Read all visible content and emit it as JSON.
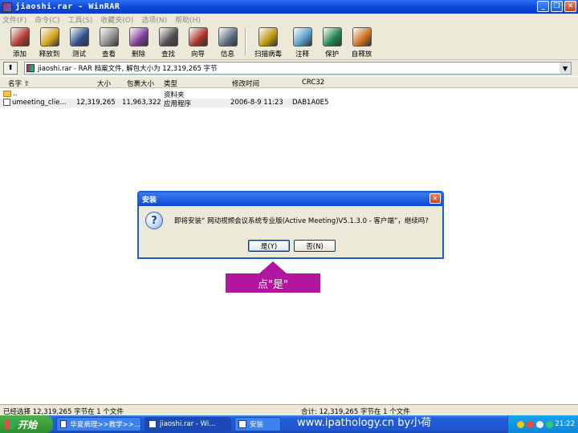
{
  "window": {
    "title": "jiaoshi.rar - WinRAR"
  },
  "menu": [
    "文件(F)",
    "命令(C)",
    "工具(S)",
    "收藏夹(O)",
    "选项(N)",
    "帮助(H)"
  ],
  "toolbar": [
    {
      "label": "添加",
      "icon": "add-icon",
      "color": "#b03a2e"
    },
    {
      "label": "释放到",
      "icon": "extract-to-icon",
      "color": "#d4a017"
    },
    {
      "label": "测试",
      "icon": "test-icon",
      "color": "#2e4d8f"
    },
    {
      "label": "查看",
      "icon": "view-icon",
      "color": "#8a8a8a"
    },
    {
      "label": "删除",
      "icon": "delete-icon",
      "color": "#7d3c98"
    },
    {
      "label": "查找",
      "icon": "find-icon",
      "color": "#4d4d4d"
    },
    {
      "label": "向导",
      "icon": "wizard-icon",
      "color": "#a93226"
    },
    {
      "label": "信息",
      "icon": "info-icon",
      "color": "#5d6d7e"
    },
    {
      "label": "扫描病毒",
      "icon": "virus-scan-icon",
      "color": "#b7950b"
    },
    {
      "label": "注释",
      "icon": "comment-icon",
      "color": "#5499c7"
    },
    {
      "label": "保护",
      "icon": "protect-icon",
      "color": "#1e8449"
    },
    {
      "label": "自释放",
      "icon": "sfx-icon",
      "color": "#ca6f1e"
    }
  ],
  "address": {
    "text": "jiaoshi.rar - RAR 档案文件, 解包大小为 12,319,265 字节"
  },
  "columns": {
    "name": "名字",
    "size": "大小",
    "packed": "包裹大小",
    "type": "类型",
    "modified": "修改时间",
    "crc": "CRC32"
  },
  "files": [
    {
      "name": "..",
      "size": "",
      "packed": "",
      "type": "资料夹",
      "modified": "",
      "crc": ""
    },
    {
      "name": "umeeting_clie...",
      "size": "12,319,265",
      "packed": "11,963,322",
      "type": "应用程序",
      "modified": "2006-8-9 11:23",
      "crc": "DAB1A0E5"
    }
  ],
  "status": {
    "left": "已经选择 12,319,265 字节在 1 个文件",
    "right": "合计: 12,319,265 字节在 1 个文件"
  },
  "dialog": {
    "title": "安装",
    "message": "即将安装“ 网动视频会议系统专业版(Active Meeting)V5.1.3.0 - 客户端”，继续吗?",
    "yes": "是(Y)",
    "no": "否(N)"
  },
  "annotation": {
    "text": "点\"是\""
  },
  "taskbar": {
    "start": "开始",
    "tasks": [
      "华夏病理>>教学>>...",
      "jiaoshi.rar - Wi...",
      "安装"
    ],
    "watermark": "www.ipathology.cn  by小荷",
    "clock": "21:22"
  }
}
